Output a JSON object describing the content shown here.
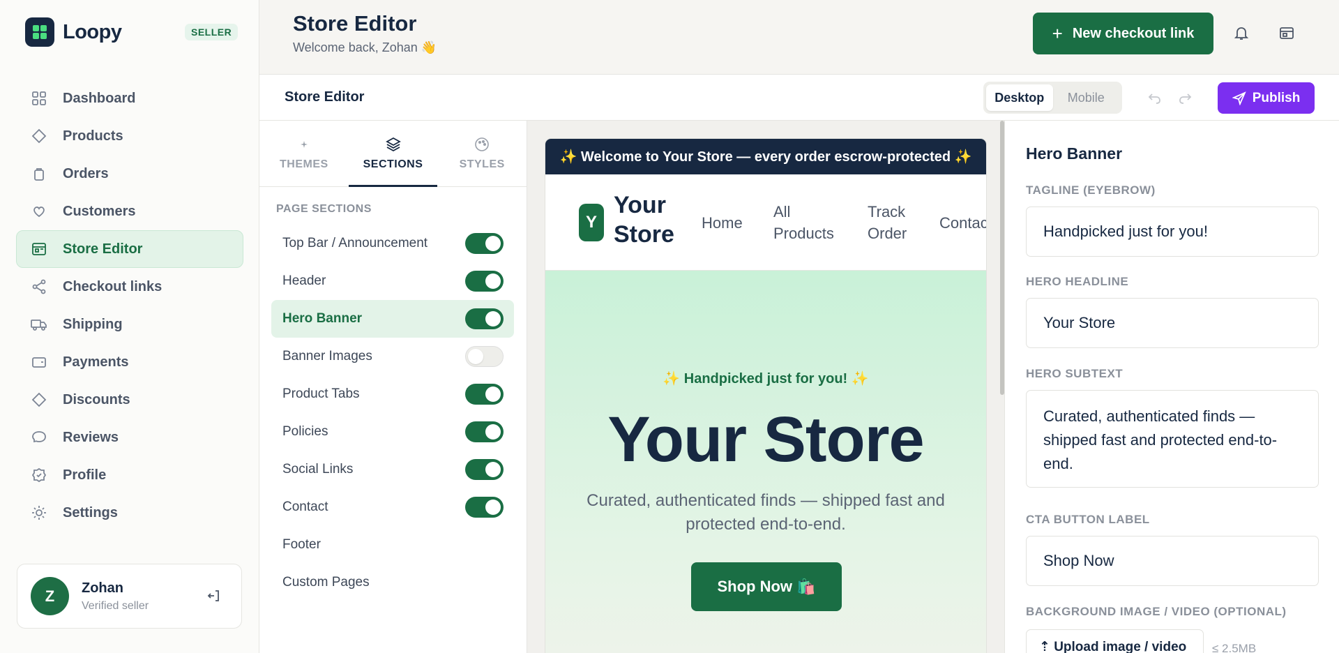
{
  "brand": {
    "name": "Loopy",
    "badge": "SELLER"
  },
  "nav": {
    "items": [
      {
        "label": "Dashboard",
        "icon": "grid-icon"
      },
      {
        "label": "Products",
        "icon": "tag-icon"
      },
      {
        "label": "Orders",
        "icon": "bag-icon"
      },
      {
        "label": "Customers",
        "icon": "heart-icon"
      },
      {
        "label": "Store Editor",
        "icon": "store-icon",
        "active": true
      },
      {
        "label": "Checkout links",
        "icon": "share-icon"
      },
      {
        "label": "Shipping",
        "icon": "truck-icon"
      },
      {
        "label": "Payments",
        "icon": "wallet-icon"
      },
      {
        "label": "Discounts",
        "icon": "tag-icon"
      },
      {
        "label": "Reviews",
        "icon": "chat-icon"
      },
      {
        "label": "Profile",
        "icon": "badge-icon"
      },
      {
        "label": "Settings",
        "icon": "sun-gear-icon"
      }
    ]
  },
  "user": {
    "initial": "Z",
    "name": "Zohan",
    "status": "Verified seller"
  },
  "header": {
    "title": "Store Editor",
    "subtitle": "Welcome back, Zohan 👋",
    "new_link_label": "New checkout link"
  },
  "editor": {
    "title": "Store Editor",
    "view_desktop": "Desktop",
    "view_mobile": "Mobile",
    "publish_label": "Publish"
  },
  "panel": {
    "tabs": [
      {
        "label": "THEMES",
        "icon": "sparkle-icon"
      },
      {
        "label": "SECTIONS",
        "icon": "layers-icon",
        "active": true
      },
      {
        "label": "STYLES",
        "icon": "palette-icon"
      }
    ],
    "heading": "PAGE SECTIONS",
    "sections": [
      {
        "label": "Top Bar / Announcement",
        "toggle": "on"
      },
      {
        "label": "Header",
        "toggle": "on"
      },
      {
        "label": "Hero Banner",
        "toggle": "on",
        "active": true
      },
      {
        "label": "Banner Images",
        "toggle": "off"
      },
      {
        "label": "Product Tabs",
        "toggle": "on"
      },
      {
        "label": "Policies",
        "toggle": "on"
      },
      {
        "label": "Social Links",
        "toggle": "on"
      },
      {
        "label": "Contact",
        "toggle": "on"
      },
      {
        "label": "Footer",
        "toggle": "none"
      },
      {
        "label": "Custom Pages",
        "toggle": "none"
      }
    ]
  },
  "preview": {
    "announcement": "✨ Welcome to Your Store — every order escrow-protected ✨",
    "logo_initial": "Y",
    "store_name": "Your Store",
    "nav": [
      "Home",
      "All Products",
      "Track Order",
      "Contact"
    ],
    "hero_tag": "✨ Handpicked just for you! ✨",
    "hero_title": "Your Store",
    "hero_sub": "Curated, authenticated finds — shipped fast and protected end-to-end.",
    "hero_cta": "Shop Now 🛍️"
  },
  "props": {
    "title": "Hero Banner",
    "tagline_label": "TAGLINE (EYEBROW)",
    "tagline_value": "Handpicked just for you!",
    "headline_label": "HERO HEADLINE",
    "headline_value": "Your Store",
    "subtext_label": "HERO SUBTEXT",
    "subtext_value": "Curated, authenticated finds — shipped fast and protected end-to-end.",
    "cta_label": "CTA BUTTON LABEL",
    "cta_value": "Shop Now",
    "bg_label": "BACKGROUND IMAGE / VIDEO (OPTIONAL)",
    "upload_label": "⇡ Upload image / video",
    "upload_hint": "≤ 2.5MB"
  },
  "colors": {
    "accent": "#1a6e44",
    "navy": "#172841",
    "publish": "#7b2ff0"
  }
}
